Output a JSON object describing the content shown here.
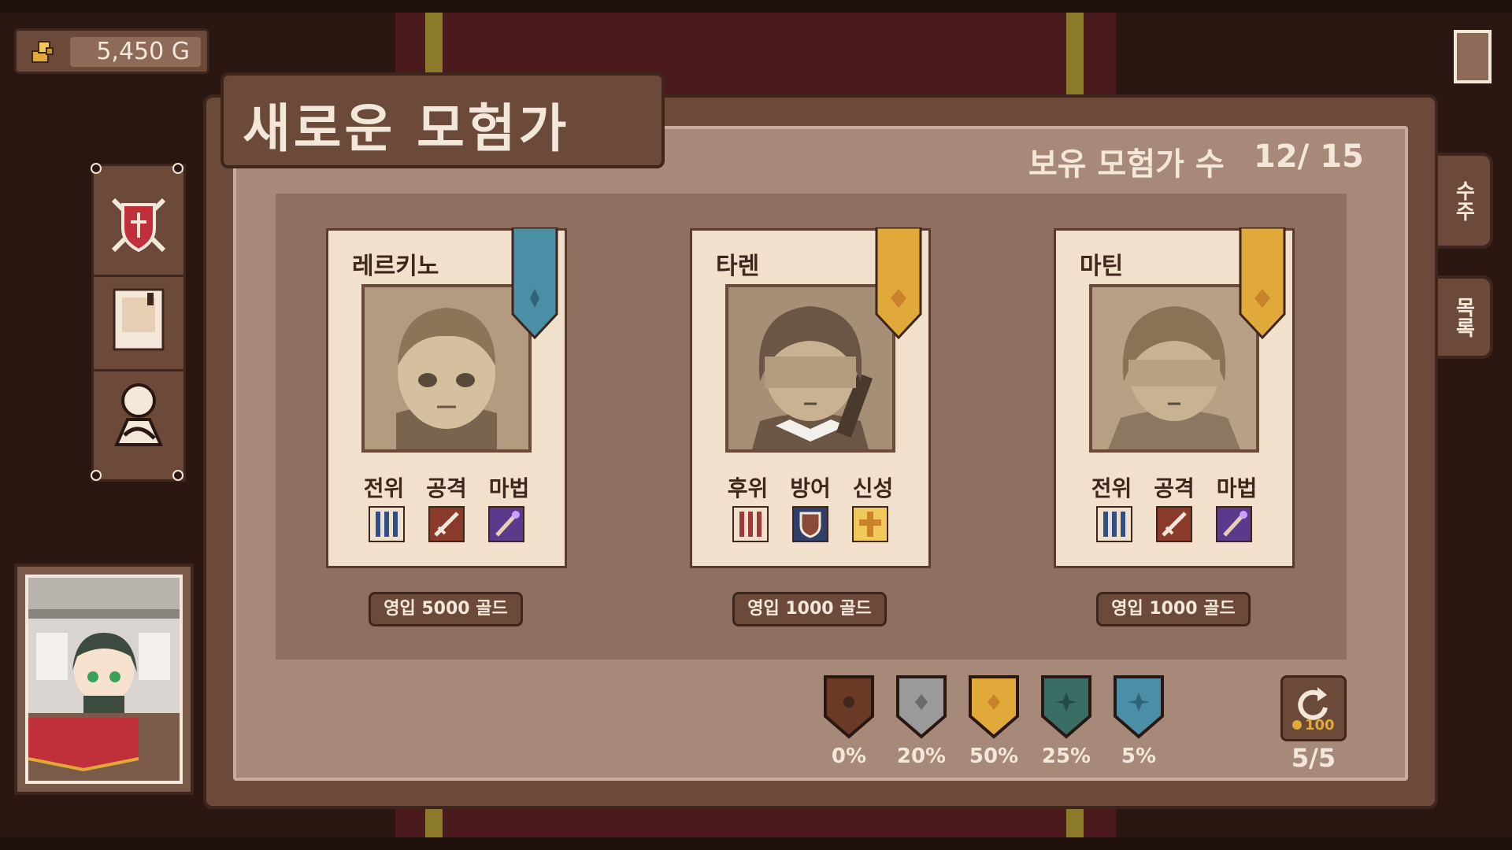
{
  "hud": {
    "gold": "5,450 G"
  },
  "window": {
    "title": "새로운 모험가",
    "roster_label": "보유 모험가 수",
    "roster_count": "12/ 15"
  },
  "side_tabs": [
    "수주",
    "목록"
  ],
  "candidates": [
    {
      "name": "레르키노",
      "rank_color": "#4a8fa6",
      "traits": [
        "전위",
        "공격",
        "마법"
      ],
      "recruit_label": "영입 5000 골드"
    },
    {
      "name": "타렌",
      "rank_color": "#e0a93a",
      "traits": [
        "후위",
        "방어",
        "신성"
      ],
      "recruit_label": "영입 1000 골드"
    },
    {
      "name": "마틴",
      "rank_color": "#e0a93a",
      "traits": [
        "전위",
        "공격",
        "마법"
      ],
      "recruit_label": "영입 1000 골드"
    }
  ],
  "rarity_rates": [
    {
      "color": "#6b3a26",
      "pct": "0%"
    },
    {
      "color": "#9a9a9a",
      "pct": "20%"
    },
    {
      "color": "#e0a93a",
      "pct": "50%"
    },
    {
      "color": "#3a6e64",
      "pct": "25%"
    },
    {
      "color": "#4a8fa6",
      "pct": "5%"
    }
  ],
  "refresh": {
    "cost": "100",
    "count": "5/5"
  },
  "icons": [
    "gold-icon",
    "guild-shield-icon",
    "notes-icon",
    "adventurer-icon",
    "refresh-icon"
  ]
}
